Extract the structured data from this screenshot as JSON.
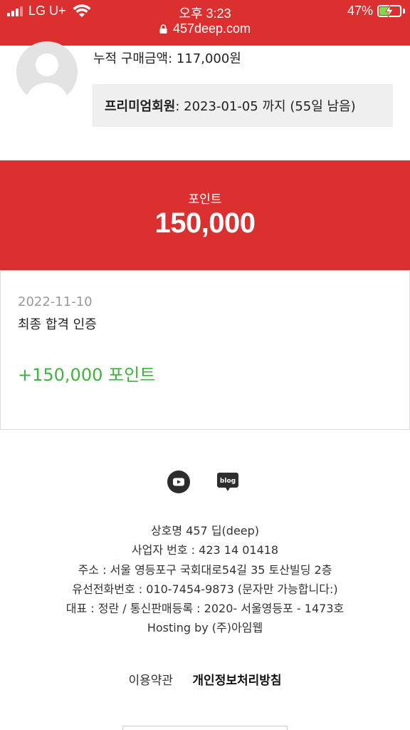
{
  "status_bar": {
    "carrier": "LG U+",
    "time": "오후 3:23",
    "battery_percent": "47%",
    "battery_level": 0.47,
    "charging": true
  },
  "browser": {
    "url": "457deep.com"
  },
  "profile": {
    "total_purchase": "누적 구매금액: 117,000원",
    "premium_label": "프리미엄회원",
    "premium_detail": ": 2023-01-05 까지 (55일 남음)"
  },
  "points": {
    "label": "포인트",
    "value": "150,000"
  },
  "history": [
    {
      "date": "2022-11-10",
      "title": "최종 합격 인증",
      "amount": "+150,000 포인트"
    }
  ],
  "footer": {
    "social": [
      "youtube-icon",
      "blog-icon"
    ],
    "blog_text": "blog",
    "info_lines": [
      "상호명 457 딥(deep)",
      "사업자 번호 : 423 14 01418",
      "주소 : 서울 영등포구 국회대로54길 35 토산빌딩 2층",
      "유선전화번호 : 010-7454-9873 (문자만 가능합니다:)",
      "대표 : 정란 / 통신판매등록 : 2020- 서울영등포 - 1473호",
      "Hosting by (주)아임웹"
    ],
    "links": {
      "terms": "이용약관",
      "privacy": "개인정보처리방침"
    }
  },
  "colors": {
    "brand_red": "#dc2f2f",
    "point_green": "#3cb43c"
  }
}
